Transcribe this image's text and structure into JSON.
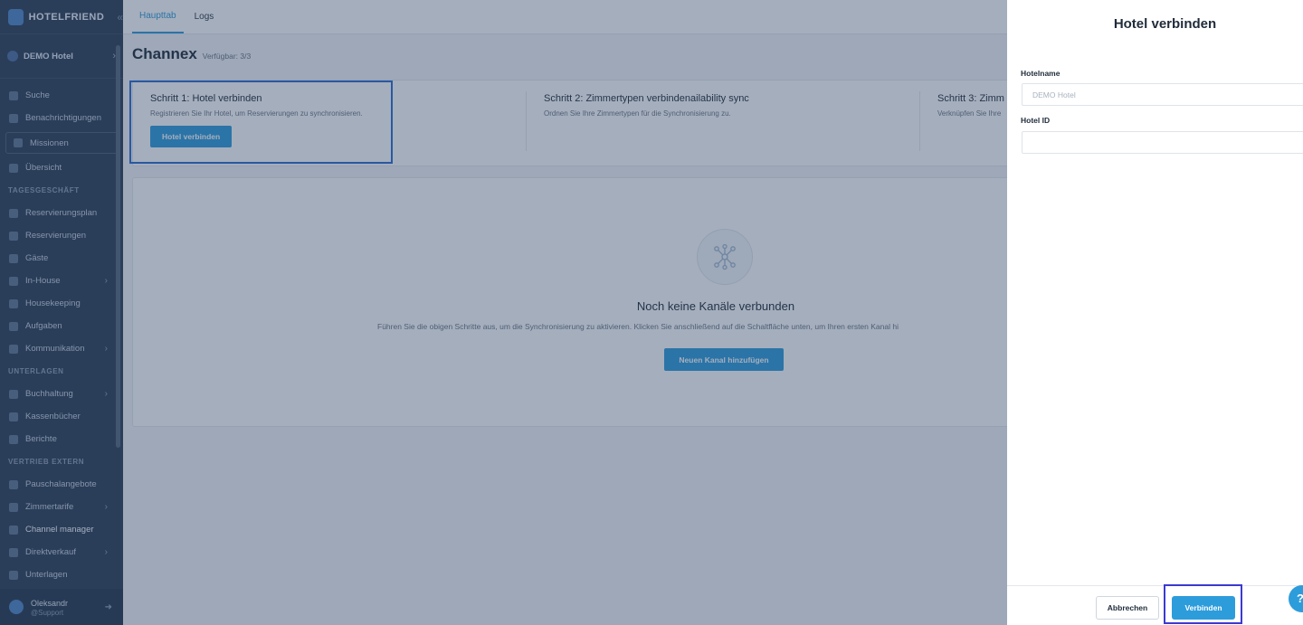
{
  "brand": {
    "name": "HOTELFRIEND",
    "collapse_icon": "double-chevron-left-icon"
  },
  "hotel_selector": {
    "label": "DEMO Hotel"
  },
  "sidebar": {
    "items": [
      {
        "label": "Suche",
        "icon": "search-icon"
      },
      {
        "label": "Benachrichtigungen",
        "icon": "bell-icon"
      },
      {
        "label": "Missionen",
        "icon": "flag-icon"
      },
      {
        "label": "Übersicht",
        "icon": "dashboard-icon"
      }
    ],
    "sections": [
      {
        "title": "TAGESGESCHÄFT",
        "items": [
          {
            "label": "Reservierungsplan",
            "icon": "calendar-icon"
          },
          {
            "label": "Reservierungen",
            "icon": "booking-icon"
          },
          {
            "label": "Gäste",
            "icon": "guests-icon"
          },
          {
            "label": "In-House",
            "icon": "house-icon"
          },
          {
            "label": "Housekeeping",
            "icon": "broom-icon"
          },
          {
            "label": "Aufgaben",
            "icon": "wrench-icon"
          },
          {
            "label": "Kommunikation",
            "icon": "chat-icon"
          }
        ]
      },
      {
        "title": "UNTERLAGEN",
        "items": [
          {
            "label": "Buchhaltung",
            "icon": "accounting-icon"
          },
          {
            "label": "Kassenbücher",
            "icon": "cashbook-icon"
          },
          {
            "label": "Berichte",
            "icon": "report-icon"
          }
        ]
      },
      {
        "title": "VERTRIEB EXTERN",
        "items": [
          {
            "label": "Pauschalangebote",
            "icon": "tag-icon"
          },
          {
            "label": "Zimmertarife",
            "icon": "rates-icon"
          },
          {
            "label": "Channel manager",
            "icon": "channel-icon"
          },
          {
            "label": "Direktverkauf",
            "icon": "sale-icon"
          },
          {
            "label": "Unterlagen",
            "icon": "folder-icon"
          }
        ]
      }
    ]
  },
  "user": {
    "name": "Oleksandr",
    "role": "@Support"
  },
  "tabs": [
    {
      "label": "Haupttab"
    },
    {
      "label": "Logs"
    }
  ],
  "page": {
    "title": "Channex",
    "subtitle": "Verfügbar: 3/3"
  },
  "steps": [
    {
      "title": "Schritt 1: Hotel verbinden",
      "desc": "Registrieren Sie Ihr Hotel, um Reservierungen zu synchronisieren.",
      "button": "Hotel verbinden"
    },
    {
      "title": "Schritt 2: Zimmertypen verbindenailability sync",
      "desc": "Ordnen Sie Ihre Zimmertypen für die Synchronisierung zu."
    },
    {
      "title": "Schritt 3: Zimm",
      "desc": "Verknüpfen Sie Ihre"
    }
  ],
  "empty_state": {
    "title": "Noch keine Kanäle verbunden",
    "desc": "Führen Sie die obigen Schritte aus, um die Synchronisierung zu aktivieren. Klicken Sie anschließend auf die Schaltfläche unten, um Ihren ersten Kanal hi",
    "button": "Neuen Kanal hinzufügen",
    "icon": "network-icon"
  },
  "drawer": {
    "title": "Hotel verbinden",
    "hotel_name": {
      "label": "Hotelname",
      "placeholder": "DEMO Hotel",
      "value": ""
    },
    "hotel_id": {
      "label": "Hotel ID",
      "placeholder": "",
      "value": ""
    },
    "cancel": "Abbrechen",
    "connect": "Verbinden"
  },
  "help": {
    "label": "?"
  },
  "colors": {
    "accent": "#2d9cdb",
    "sidebar": "#2c3e57",
    "highlight_step": "#2a6cd0",
    "highlight_button": "#3b3ad0"
  }
}
